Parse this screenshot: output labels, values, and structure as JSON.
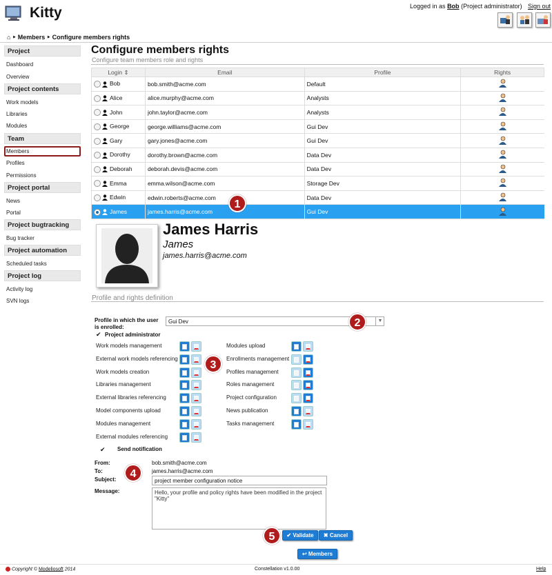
{
  "app": {
    "title": "Kitty"
  },
  "header": {
    "logged_in_prefix": "Logged in as",
    "user": "Bob",
    "role": "(Project administrator)",
    "signout": "Sign out"
  },
  "breadcrumb": {
    "home_icon": "home-icon",
    "items": [
      "Members",
      "Configure members rights"
    ]
  },
  "sidebar": {
    "groups": [
      {
        "title": "Project",
        "items": [
          "Dashboard",
          "Overview"
        ]
      },
      {
        "title": "Project contents",
        "items": [
          "Work models",
          "Libraries",
          "Modules"
        ]
      },
      {
        "title": "Team",
        "items": [
          "Members",
          "Profiles",
          "Permissions"
        ]
      },
      {
        "title": "Project portal",
        "items": [
          "News",
          "Portal"
        ]
      },
      {
        "title": "Project bugtracking",
        "items": [
          "Bug tracker"
        ]
      },
      {
        "title": "Project automation",
        "items": [
          "Scheduled tasks"
        ]
      },
      {
        "title": "Project log",
        "items": [
          "Activity log",
          "SVN logs"
        ]
      }
    ],
    "active": "Members"
  },
  "page": {
    "title": "Configure members rights",
    "subtitle": "Configure team members role and rights"
  },
  "table": {
    "headers": [
      "Login",
      "Email",
      "Profile",
      "Rights"
    ],
    "rows": [
      {
        "login": "Bob",
        "email": "bob.smith@acme.com",
        "profile": "Default"
      },
      {
        "login": "Alice",
        "email": "alice.murphy@acme.com",
        "profile": "Analysts"
      },
      {
        "login": "John",
        "email": "john.taylor@acme.com",
        "profile": "Analysts"
      },
      {
        "login": "George",
        "email": "george.williams@acme.com",
        "profile": "Gui Dev"
      },
      {
        "login": "Gary",
        "email": "gary.jones@acme.com",
        "profile": "Gui Dev"
      },
      {
        "login": "Dorothy",
        "email": "dorothy.brown@acme.com",
        "profile": "Data Dev"
      },
      {
        "login": "Deborah",
        "email": "deborah.devis@acme.com",
        "profile": "Data Dev"
      },
      {
        "login": "Emma",
        "email": "emma.wilson@acme.com",
        "profile": "Storage Dev"
      },
      {
        "login": "Edwin",
        "email": "edwin.roberts@acme.com",
        "profile": "Data Dev"
      },
      {
        "login": "James",
        "email": "james.harris@acme.com",
        "profile": "Gui Dev"
      }
    ],
    "selected": "James"
  },
  "detail": {
    "full_name": "James Harris",
    "first_name": "James",
    "email": "james.harris@acme.com"
  },
  "rights": {
    "section_title": "Profile and rights definition",
    "profile_label": "Profile in which the user is enrolled:",
    "profile_value": "Gui Dev",
    "project_admin_label": "Project administrator",
    "project_admin_checked": true,
    "permissions_left": [
      {
        "label": "Work models management",
        "read": true,
        "write": false
      },
      {
        "label": "External work models referencing",
        "read": true,
        "write": false
      },
      {
        "label": "Work models creation",
        "read": true,
        "write": false
      },
      {
        "label": "Libraries management",
        "read": true,
        "write": false
      },
      {
        "label": "External libraries referencing",
        "read": true,
        "write": false
      },
      {
        "label": "Model components upload",
        "read": true,
        "write": false
      },
      {
        "label": "Modules management",
        "read": true,
        "write": false
      },
      {
        "label": "External modules referencing",
        "read": true,
        "write": false
      }
    ],
    "permissions_right": [
      {
        "label": "Modules upload",
        "read": true,
        "write": false
      },
      {
        "label": "Enrollments management",
        "read": false,
        "write": true
      },
      {
        "label": "Profiles management",
        "read": false,
        "write": true
      },
      {
        "label": "Roles management",
        "read": false,
        "write": true
      },
      {
        "label": "Project configuration",
        "read": false,
        "write": true
      },
      {
        "label": "News publication",
        "read": true,
        "write": false
      },
      {
        "label": "Tasks management",
        "read": true,
        "write": false
      }
    ],
    "send_notification_label": "Send notification",
    "send_notification_checked": true
  },
  "mail": {
    "from_label": "From:",
    "from": "bob.smith@acme.com",
    "to_label": "To:",
    "to": "james.harris@acme.com",
    "subject_label": "Subject:",
    "subject": "project member configuration notice",
    "message_label": "Message:",
    "message": "Hello, your profile and policy rights have been modified in the project \"Kitty\""
  },
  "buttons": {
    "validate": "Validate",
    "cancel": "Cancel",
    "members": "Members"
  },
  "callouts": [
    "1",
    "2",
    "3",
    "4",
    "5"
  ],
  "footer": {
    "copyright": "Copyright ©",
    "company": "Modeliosoft",
    "year": "2014",
    "version": "Constellation v1.0.00",
    "help": "Help"
  },
  "colors": {
    "selected_row": "#2aa0f0",
    "button": "#1e7cd4",
    "callout": "#b01c1c",
    "active_outline": "#8b1a1a"
  }
}
